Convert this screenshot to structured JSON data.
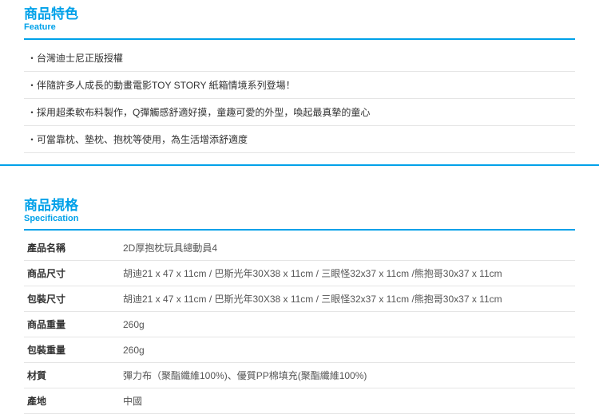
{
  "feature": {
    "title": "商品特色",
    "subtitle": "Feature",
    "items": [
      "台灣迪士尼正版授權",
      "伴隨許多人成長的動畫電影TOY STORY 紙箱情境系列登場！",
      "採用超柔軟布料製作，Q彈觸感舒適好摸，童趣可愛的外型，喚起最真摰的童心",
      "可當靠枕、墊枕、抱枕等使用，為生活增添舒適度"
    ]
  },
  "spec": {
    "title": "商品規格",
    "subtitle": "Specification",
    "rows": [
      {
        "label": "產品名稱",
        "value": "2D厚抱枕玩具總動員4"
      },
      {
        "label": "商品尺寸",
        "value": "胡迪21 x 47 x 11cm / 巴斯光年30X38 x 11cm / 三眼怪32x37 x 11cm /熊抱哥30x37 x 11cm"
      },
      {
        "label": "包裝尺寸",
        "value": "胡迪21 x 47 x 11cm / 巴斯光年30X38 x 11cm / 三眼怪32x37 x 11cm /熊抱哥30x37 x 11cm"
      },
      {
        "label": "商品重量",
        "value": "260g"
      },
      {
        "label": "包裝重量",
        "value": "260g"
      },
      {
        "label": "材質",
        "value": "彈力布（聚酯纖維100%)、優質PP棉填充(聚酯纖維100%)"
      },
      {
        "label": "產地",
        "value": "中國"
      }
    ]
  }
}
